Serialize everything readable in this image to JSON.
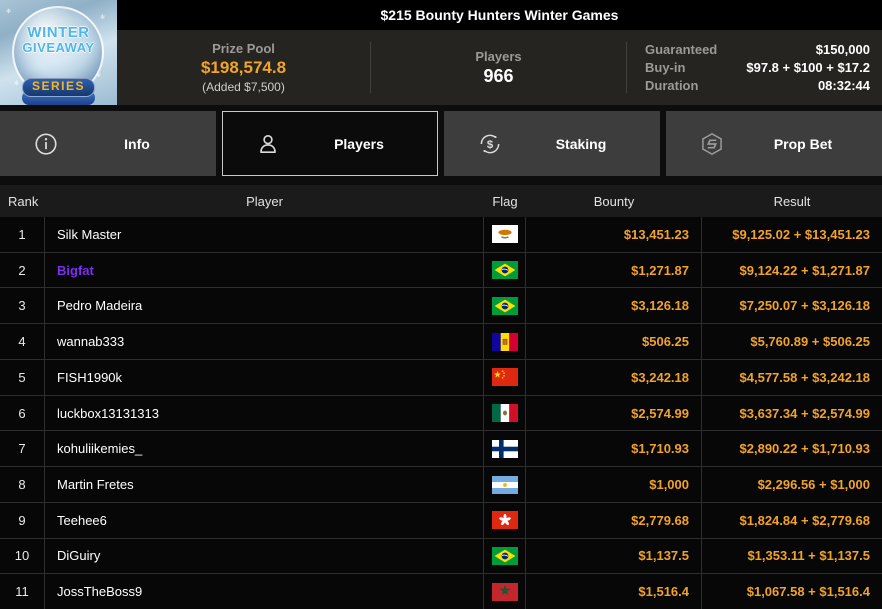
{
  "window": {
    "title": "$215 Bounty Hunters Winter Games"
  },
  "logo": {
    "line1": "WINTER",
    "line2": "GIVEAWAY",
    "line3": "SERIES"
  },
  "header": {
    "prize_pool": {
      "label": "Prize Pool",
      "value": "$198,574.8",
      "added": "(Added $7,500)"
    },
    "players": {
      "label": "Players",
      "value": "966"
    },
    "stats": [
      {
        "label": "Guaranteed",
        "value": "$150,000"
      },
      {
        "label": "Buy-in",
        "value": "$97.8 + $100 + $17.2"
      },
      {
        "label": "Duration",
        "value": "08:32:44"
      }
    ]
  },
  "tabs": [
    {
      "label": "Info",
      "icon": "info-icon",
      "active": false
    },
    {
      "label": "Players",
      "icon": "players-icon",
      "active": true
    },
    {
      "label": "Staking",
      "icon": "staking-icon",
      "active": false
    },
    {
      "label": "Prop Bet",
      "icon": "prop-bet-icon",
      "active": false
    }
  ],
  "table": {
    "columns": [
      "Rank",
      "Player",
      "Flag",
      "Bounty",
      "Result"
    ],
    "rows": [
      {
        "rank": "1",
        "player": "Silk Master",
        "flag": "cyprus",
        "bounty": "$13,451.23",
        "result": "$9,125.02 + $13,451.23",
        "highlight": false
      },
      {
        "rank": "2",
        "player": "Bigfat",
        "flag": "brazil",
        "bounty": "$1,271.87",
        "result": "$9,124.22 + $1,271.87",
        "highlight": true
      },
      {
        "rank": "3",
        "player": "Pedro Madeira",
        "flag": "brazil",
        "bounty": "$3,126.18",
        "result": "$7,250.07 + $3,126.18",
        "highlight": false
      },
      {
        "rank": "4",
        "player": "wannab333",
        "flag": "andorra",
        "bounty": "$506.25",
        "result": "$5,760.89 + $506.25",
        "highlight": false
      },
      {
        "rank": "5",
        "player": "FISH1990k",
        "flag": "china",
        "bounty": "$3,242.18",
        "result": "$4,577.58 + $3,242.18",
        "highlight": false
      },
      {
        "rank": "6",
        "player": "luckbox13131313",
        "flag": "mexico",
        "bounty": "$2,574.99",
        "result": "$3,637.34 + $2,574.99",
        "highlight": false
      },
      {
        "rank": "7",
        "player": "kohuliikemies_",
        "flag": "finland",
        "bounty": "$1,710.93",
        "result": "$2,890.22 + $1,710.93",
        "highlight": false
      },
      {
        "rank": "8",
        "player": "Martin Fretes",
        "flag": "argentina",
        "bounty": "$1,000",
        "result": "$2,296.56 + $1,000",
        "highlight": false
      },
      {
        "rank": "9",
        "player": "Teehee6",
        "flag": "hong-kong",
        "bounty": "$2,779.68",
        "result": "$1,824.84 + $2,779.68",
        "highlight": false
      },
      {
        "rank": "10",
        "player": "DiGuiry",
        "flag": "brazil",
        "bounty": "$1,137.5",
        "result": "$1,353.11 + $1,137.5",
        "highlight": false
      },
      {
        "rank": "11",
        "player": "JossTheBoss9",
        "flag": "morocco",
        "bounty": "$1,516.4",
        "result": "$1,067.58 + $1,516.4",
        "highlight": false
      }
    ]
  },
  "colors": {
    "accent_gold": "#f2a32a",
    "highlight_purple": "#7b2ff2"
  }
}
